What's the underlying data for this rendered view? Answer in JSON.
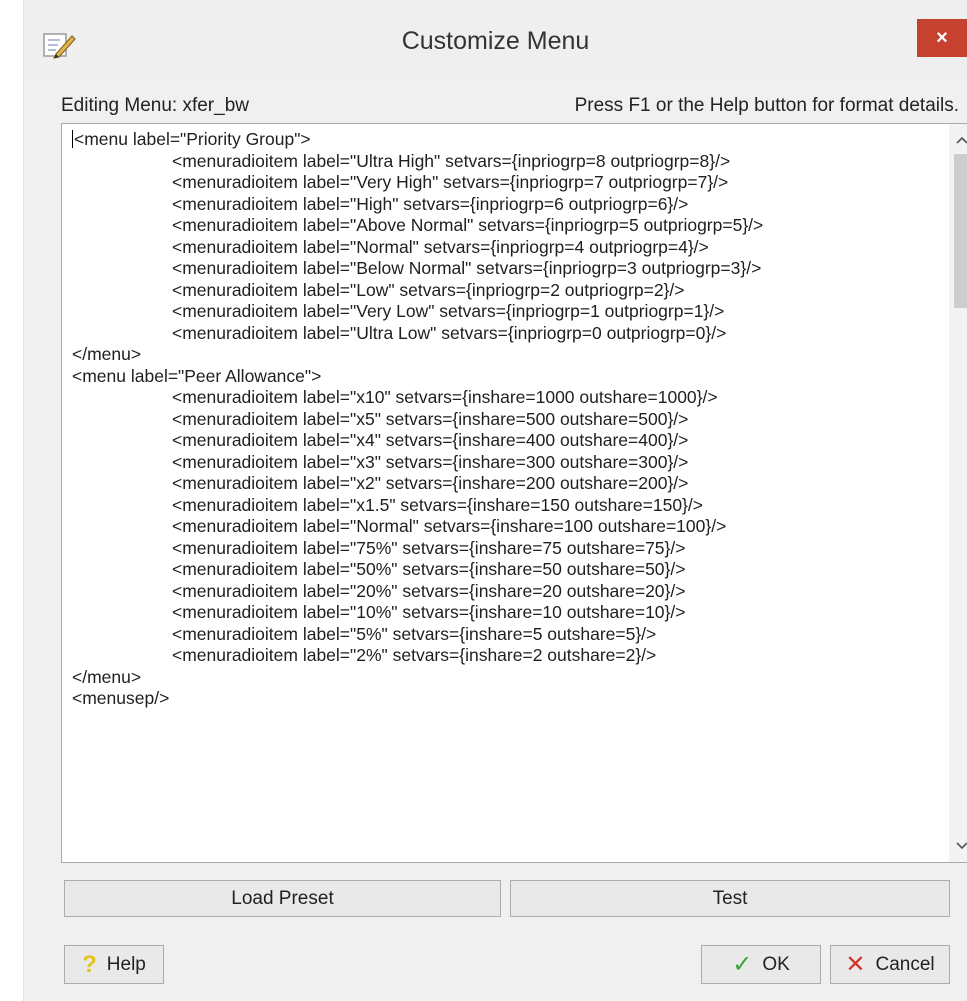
{
  "window": {
    "title": "Customize Menu",
    "close_label": "×",
    "editing_label": "Editing Menu: xfer_bw",
    "help_hint": "Press F1 or the Help button for format details."
  },
  "editor": {
    "lines": [
      {
        "indent": 0,
        "text": "<menu label=\"Priority Group\">"
      },
      {
        "indent": 1,
        "text": "<menuradioitem label=\"Ultra High\" setvars={inpriogrp=8 outpriogrp=8}/>"
      },
      {
        "indent": 1,
        "text": "<menuradioitem label=\"Very High\" setvars={inpriogrp=7 outpriogrp=7}/>"
      },
      {
        "indent": 1,
        "text": "<menuradioitem label=\"High\" setvars={inpriogrp=6 outpriogrp=6}/>"
      },
      {
        "indent": 1,
        "text": "<menuradioitem label=\"Above Normal\" setvars={inpriogrp=5 outpriogrp=5}/>"
      },
      {
        "indent": 1,
        "text": "<menuradioitem label=\"Normal\" setvars={inpriogrp=4 outpriogrp=4}/>"
      },
      {
        "indent": 1,
        "text": "<menuradioitem label=\"Below Normal\" setvars={inpriogrp=3 outpriogrp=3}/>"
      },
      {
        "indent": 1,
        "text": "<menuradioitem label=\"Low\" setvars={inpriogrp=2 outpriogrp=2}/>"
      },
      {
        "indent": 1,
        "text": "<menuradioitem label=\"Very Low\" setvars={inpriogrp=1 outpriogrp=1}/>"
      },
      {
        "indent": 1,
        "text": "<menuradioitem label=\"Ultra Low\" setvars={inpriogrp=0 outpriogrp=0}/>"
      },
      {
        "indent": 0,
        "text": "</menu>"
      },
      {
        "indent": 0,
        "text": "<menu label=\"Peer Allowance\">"
      },
      {
        "indent": 1,
        "text": "<menuradioitem label=\"x10\" setvars={inshare=1000 outshare=1000}/>"
      },
      {
        "indent": 1,
        "text": "<menuradioitem label=\"x5\" setvars={inshare=500 outshare=500}/>"
      },
      {
        "indent": 1,
        "text": "<menuradioitem label=\"x4\" setvars={inshare=400 outshare=400}/>"
      },
      {
        "indent": 1,
        "text": "<menuradioitem label=\"x3\" setvars={inshare=300 outshare=300}/>"
      },
      {
        "indent": 1,
        "text": "<menuradioitem label=\"x2\" setvars={inshare=200 outshare=200}/>"
      },
      {
        "indent": 1,
        "text": "<menuradioitem label=\"x1.5\" setvars={inshare=150 outshare=150}/>"
      },
      {
        "indent": 1,
        "text": "<menuradioitem label=\"Normal\" setvars={inshare=100 outshare=100}/>"
      },
      {
        "indent": 1,
        "text": "<menuradioitem label=\"75%\" setvars={inshare=75 outshare=75}/>"
      },
      {
        "indent": 1,
        "text": "<menuradioitem label=\"50%\" setvars={inshare=50 outshare=50}/>"
      },
      {
        "indent": 1,
        "text": "<menuradioitem label=\"20%\" setvars={inshare=20 outshare=20}/>"
      },
      {
        "indent": 1,
        "text": "<menuradioitem label=\"10%\" setvars={inshare=10 outshare=10}/>"
      },
      {
        "indent": 1,
        "text": "<menuradioitem label=\"5%\" setvars={inshare=5 outshare=5}/>"
      },
      {
        "indent": 1,
        "text": "<menuradioitem label=\"2%\" setvars={inshare=2 outshare=2}/>"
      },
      {
        "indent": 0,
        "text": "</menu>"
      },
      {
        "indent": 0,
        "text": "<menusep/>"
      }
    ]
  },
  "buttons": {
    "load_preset": "Load Preset",
    "test": "Test",
    "help": "Help",
    "ok": "OK",
    "cancel": "Cancel"
  },
  "icons": {
    "app": "pencil-edit-icon",
    "help": "question-mark-icon",
    "ok": "checkmark-icon",
    "cancel": "x-mark-icon",
    "scroll_up": "chevron-up-icon",
    "scroll_down": "chevron-down-icon"
  },
  "colors": {
    "close_button": "#c7412f",
    "ok_check": "#3ea33b",
    "cancel_x": "#d3332a",
    "help_question": "#e6c31a"
  }
}
